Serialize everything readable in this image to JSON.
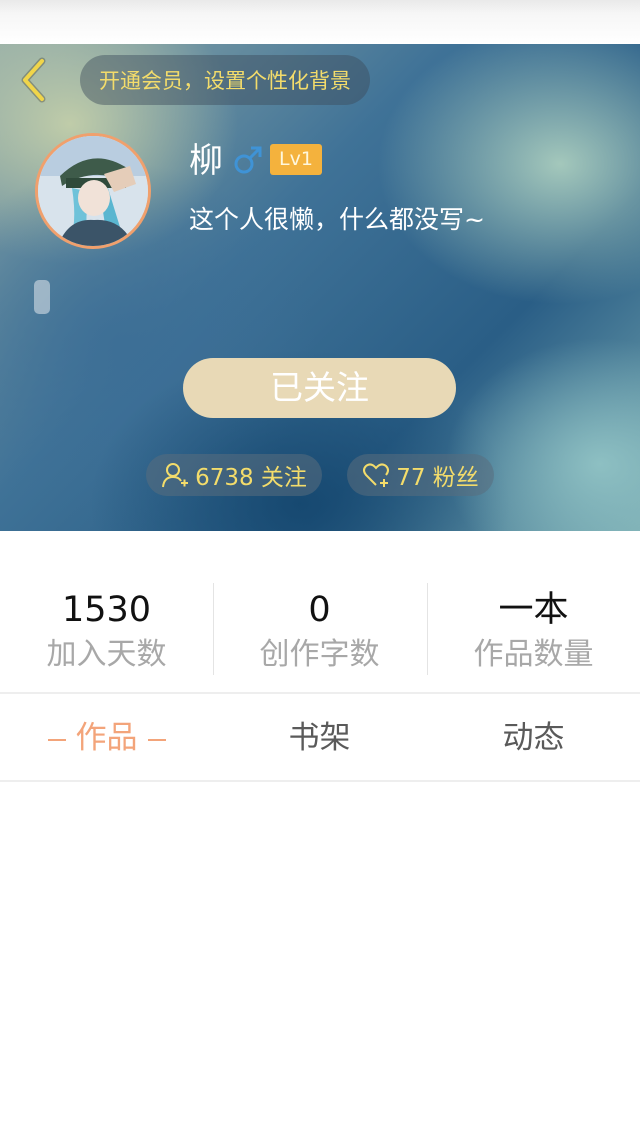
{
  "header": {
    "vip_prompt": "开通会员，设置个性化背景"
  },
  "profile": {
    "username": "柳",
    "gender_icon": "male-icon",
    "level": "Lv1",
    "signature": "这个人很懒，什么都没写~",
    "follow_button_label": "已关注",
    "following_text": "6738 关注",
    "fans_text": "77 粉丝"
  },
  "stats": [
    {
      "value": "1530",
      "label": "加入天数"
    },
    {
      "value": "0",
      "label": "创作字数"
    },
    {
      "value": "一本",
      "label": "作品数量"
    }
  ],
  "tabs": [
    {
      "label": "作品",
      "active": true
    },
    {
      "label": "书架",
      "active": false
    },
    {
      "label": "动态",
      "active": false
    }
  ],
  "colors": {
    "accent_yellow": "#f3dc6b",
    "active_tab": "#f3a47a",
    "level_badge": "#f4b23d",
    "follow_button": "#e8d9b6",
    "avatar_border": "#f0a06d",
    "gender_icon": "#3f93d6"
  }
}
